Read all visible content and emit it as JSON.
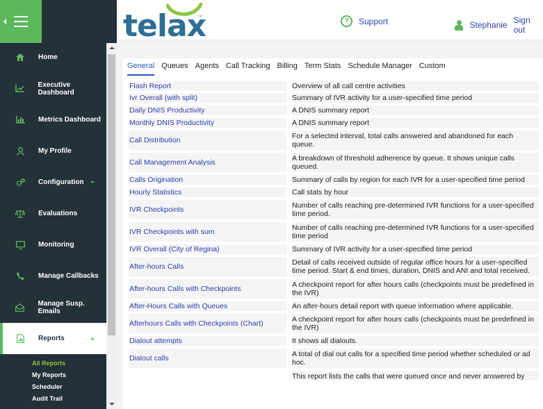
{
  "sidebar": {
    "items": [
      {
        "label": "Home",
        "icon": "home-icon"
      },
      {
        "label": "Executive Dashboard",
        "icon": "trend-chart-icon"
      },
      {
        "label": "Metrics Dashboard",
        "icon": "bar-chart-icon"
      },
      {
        "label": "My Profile",
        "icon": "user-icon"
      },
      {
        "label": "Configuration",
        "icon": "gears-icon"
      },
      {
        "label": "Evaluations",
        "icon": "balance-scale-icon"
      },
      {
        "label": "Monitoring",
        "icon": "monitor-icon"
      },
      {
        "label": "Manage Callbacks",
        "icon": "phone-icon"
      },
      {
        "label": "Manage Susp. Emails",
        "icon": "envelope-open-icon"
      },
      {
        "label": "Reports",
        "icon": "report-file-icon"
      }
    ],
    "subitems": [
      {
        "label": "All Reports"
      },
      {
        "label": "My Reports"
      },
      {
        "label": "Scheduler"
      },
      {
        "label": "Audit Trail"
      }
    ],
    "accent": "#5cb85c",
    "background": "#233139"
  },
  "header": {
    "logo": "telax",
    "logo_tm": "™",
    "support_label": "Support",
    "username": "Stephanie",
    "signout_label": "Sign out"
  },
  "tabs": [
    {
      "label": "General"
    },
    {
      "label": "Queues"
    },
    {
      "label": "Agents"
    },
    {
      "label": "Call Tracking"
    },
    {
      "label": "Billing"
    },
    {
      "label": "Term Stats"
    },
    {
      "label": "Schedule Manager"
    },
    {
      "label": "Custom"
    }
  ],
  "reports": [
    {
      "name": "Flash Report",
      "desc": "Overview of all call centre activities"
    },
    {
      "name": "Ivr Overall (with split)",
      "desc": "Summary of IVR activity for a user-specified time period"
    },
    {
      "name": "Daily DNIS Productivity",
      "desc": "A DNIS summary report"
    },
    {
      "name": "Monthly DNIS Productivity",
      "desc": "A DNIS summary report"
    },
    {
      "name": "Call Distribution",
      "desc": "For a selected interval, total calls answered and abandoned for each queue."
    },
    {
      "name": "Call Management Analysis",
      "desc": "A breakdown of threshold adherence by queue. It shows unique calls queued."
    },
    {
      "name": "Calls Origination",
      "desc": "Summary of calls by region for each IVR for a user-specified time period"
    },
    {
      "name": "Hourly Statistics",
      "desc": "Call stats by hour"
    },
    {
      "name": "IVR Checkpoints",
      "desc": "Number of calls reaching pre-determined IVR functions for a user-specified time period."
    },
    {
      "name": "IVR Checkpoints with sum",
      "desc": "Number of calls reaching pre-determined IVR functions for a user-specified time period"
    },
    {
      "name": "IVR Overall (City of Regina)",
      "desc": "Summary of IVR activity for a user-specified time period"
    },
    {
      "name": "After-hours Calls",
      "desc": "Detail of calls received outside of regular office hours for a user-specified time period. Start & end times, duration, DNIS and ANI and total received."
    },
    {
      "name": "After-hours Calls with Checkpoints",
      "desc": "A checkpoint report for after hours calls (checkpoints must be predefined in the IVR)"
    },
    {
      "name": "After-Hours Calls with Queues",
      "desc": "An after-hours detail report with queue information where applicable."
    },
    {
      "name": "Afterhours Calls with Checkpoints (Chart)",
      "desc": "A checkpoint report for after hours calls (checkpoints must be predefined in the IVR)"
    },
    {
      "name": "Dialout attempts",
      "desc": "It shows all dialouts."
    },
    {
      "name": "Dialout calls",
      "desc": "A total of dial out calls for a specified time period whether scheduled or ad hoc."
    },
    {
      "name": "",
      "desc": "This report lists the calls that were queued once and never answered by"
    }
  ]
}
